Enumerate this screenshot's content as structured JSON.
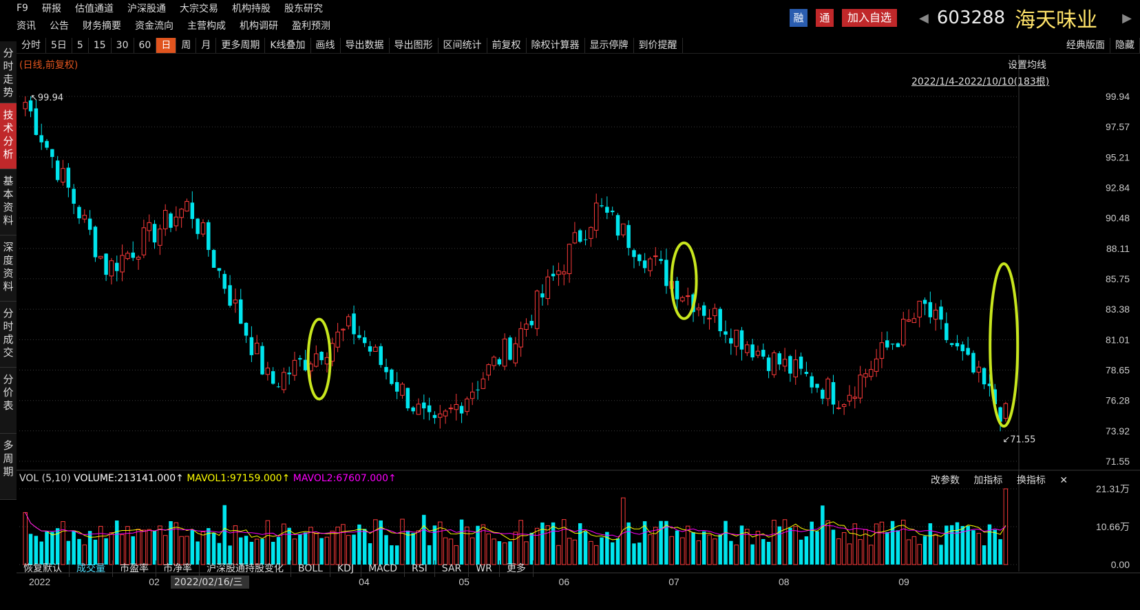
{
  "nav": {
    "row1": [
      "F9",
      "研报",
      "估值通道",
      "沪深股通",
      "大宗交易",
      "机构持股",
      "股东研究"
    ],
    "row2": [
      "资讯",
      "公告",
      "财务摘要",
      "资金流向",
      "主营构成",
      "机构调研",
      "盈利预测"
    ]
  },
  "header": {
    "badge1": "融",
    "badge2": "通",
    "add_watch": "加入自选",
    "code": "603288",
    "name": "海天味业"
  },
  "sidebar": [
    "分时走势",
    "技术分析",
    "基本资料",
    "深度资料",
    "分时成交",
    "分价表",
    "多周期"
  ],
  "toolbar": [
    "分时",
    "5日",
    "5",
    "15",
    "30",
    "60",
    "日",
    "周",
    "月",
    "更多周期",
    "K线叠加",
    "画线",
    "导出数据",
    "导出图形",
    "区间统计",
    "前复权",
    "除权计算器",
    "显示停牌",
    "到价提醒",
    "经典版面",
    "隐藏"
  ],
  "chart_labels": {
    "adj": "(日线,前复权)",
    "ma_settings": "设置均线",
    "range": "2022/1/4-2022/10/10(183根)",
    "high_label": "99.94",
    "low_label": "71.55",
    "date_cursor": "2022/02/16/三"
  },
  "vol_header": {
    "vol": "VOL (5,10)",
    "volume": "VOLUME:213141.000",
    "mavol1": "MAVOL1:97159.000",
    "mavol2": "MAVOL2:67607.000",
    "tools": [
      "改参数",
      "加指标",
      "换指标"
    ]
  },
  "bottom_tabs": [
    "恢复默认",
    "成交量",
    "市盈率",
    "市净率",
    "沪深股通持股变化",
    "BOLL",
    "KDJ",
    "MACD",
    "RSI",
    "SAR",
    "WR",
    "更多"
  ],
  "colors": {
    "up": "#ff3b3b",
    "down": "#00e5ee",
    "circle": "#c8e61e",
    "mavol1": "#ffff00",
    "mavol2": "#ff00ff"
  },
  "chart_data": {
    "type": "candlestick",
    "title": "603288 海天味业",
    "y_ticks": [
      99.94,
      97.57,
      95.21,
      92.84,
      90.48,
      88.11,
      85.75,
      83.38,
      81.01,
      78.65,
      76.28,
      73.92,
      71.55
    ],
    "ylim": [
      71.55,
      99.94
    ],
    "x_ticks": [
      "2022",
      "02",
      "04",
      "05",
      "06",
      "07",
      "08",
      "09"
    ],
    "vol_ticks": [
      "21.31万",
      "10.66万",
      "0.00"
    ],
    "approx_close_path": [
      {
        "x": "2022-01",
        "close": 99.5
      },
      {
        "x": "2022-02",
        "close": 86.5
      },
      {
        "x": "2022-03",
        "close": 91.5
      },
      {
        "x": "2022-03-mid",
        "close": 77.5
      },
      {
        "x": "2022-04",
        "close": 82.0
      },
      {
        "x": "2022-05",
        "close": 73.9
      },
      {
        "x": "2022-06",
        "close": 81.0
      },
      {
        "x": "2022-06-end",
        "close": 91.3
      },
      {
        "x": "2022-07",
        "close": 85.0
      },
      {
        "x": "2022-08",
        "close": 80.0
      },
      {
        "x": "2022-09",
        "close": 76.5
      },
      {
        "x": "2022-09-end",
        "close": 83.5
      },
      {
        "x": "2022-10-10",
        "close": 75.0
      }
    ],
    "annotations": [
      "99.94",
      "71.55"
    ]
  }
}
